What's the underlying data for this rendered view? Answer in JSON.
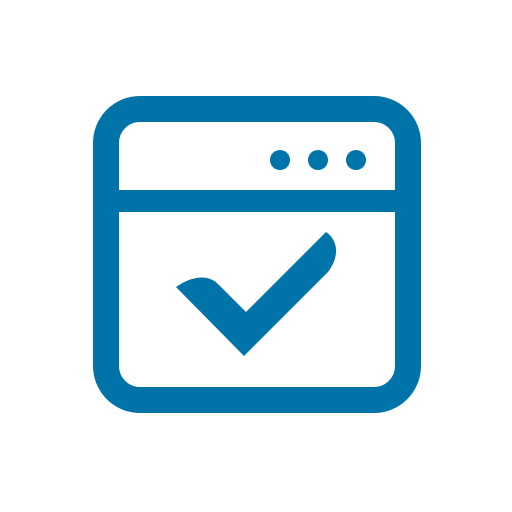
{
  "icon": {
    "name": "browser-window-check-icon",
    "color": "#0074a8",
    "background": "#ffffff",
    "parts": {
      "window_frame": "window-frame-icon",
      "title_bar_dots": [
        "dot-icon",
        "dot-icon",
        "dot-icon"
      ],
      "checkmark": "checkmark-icon"
    }
  }
}
